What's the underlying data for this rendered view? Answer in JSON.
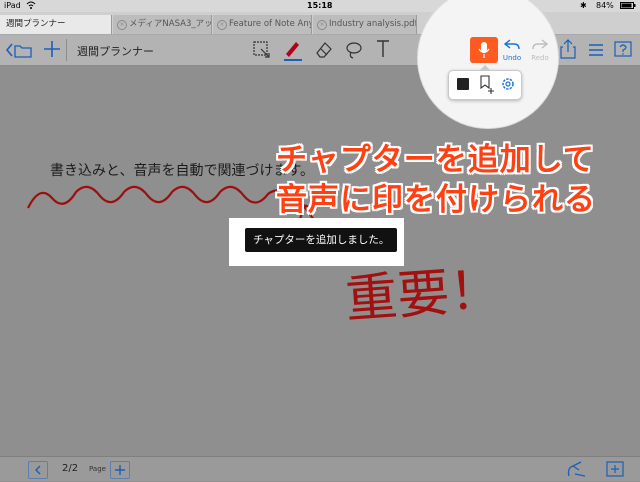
{
  "status": {
    "device": "iPad",
    "time": "15:18",
    "battery": "84%"
  },
  "tabs": [
    {
      "label": "週間プランナー",
      "active": true
    },
    {
      "label": "メディアNASA3_アッ…",
      "active": false
    },
    {
      "label": "Feature of Note Anyt…",
      "active": false
    },
    {
      "label": "Industry analysis.pdf",
      "active": false
    }
  ],
  "toolbar": {
    "doc_title": "週間プランナー",
    "undo_label": "Undo",
    "redo_label": "Redo",
    "record_color": "#ff5a1f",
    "accent": "#1a73d9"
  },
  "recording_popover": {
    "items": [
      "stop-icon",
      "add-chapter-icon",
      "settings-icon"
    ]
  },
  "page": {
    "handwritten_text": "書き込みと、音声を自動で関連づけます。",
    "annotation_word": "重要！"
  },
  "toast": {
    "message": "チャプターを追加しました。"
  },
  "callout": {
    "line1": "チャプターを追加して",
    "line2": "音声に印を付けられる",
    "color": "#ff4013"
  },
  "bottom": {
    "page_indicator": "2/2",
    "page_label": "Page"
  }
}
